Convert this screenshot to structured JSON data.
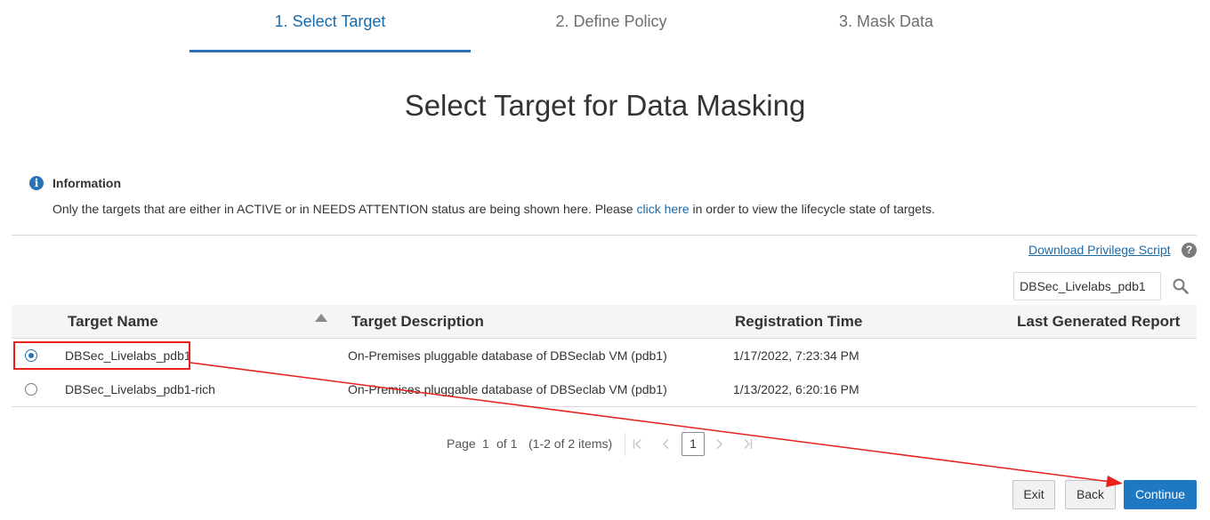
{
  "train": {
    "steps": [
      {
        "label": "1. Select Target",
        "active": true
      },
      {
        "label": "2. Define Policy",
        "active": false
      },
      {
        "label": "3. Mask Data",
        "active": false
      }
    ]
  },
  "page_title": "Select Target for Data Masking",
  "info": {
    "title": "Information",
    "text_before": "Only the targets that are either in ACTIVE or in NEEDS ATTENTION status are being shown here. Please ",
    "link": "click here",
    "text_after": " in order to view the lifecycle state of targets."
  },
  "download_link": "Download Privilege Script",
  "help_icon": "?",
  "search": {
    "value": "DBSec_Livelabs_pdb1"
  },
  "table": {
    "headers": [
      "Target Name",
      "Target Description",
      "Registration Time",
      "Last Generated Report"
    ],
    "sorted_column": "Target Name",
    "rows": [
      {
        "selected": true,
        "name": "DBSec_Livelabs_pdb1",
        "description": "On-Premises pluggable database of DBSeclab VM (pdb1)",
        "registration_time": "1/17/2022, 7:23:34 PM",
        "last_report": ""
      },
      {
        "selected": false,
        "name": "DBSec_Livelabs_pdb1-rich",
        "description": "On-Premises pluggable database of DBSeclab VM (pdb1)",
        "registration_time": "1/13/2022, 6:20:16 PM",
        "last_report": ""
      }
    ]
  },
  "pagination": {
    "page_label": "Page",
    "page": "1",
    "of_label": "of 1",
    "items": "(1-2 of 2 items)",
    "current": "1"
  },
  "buttons": {
    "exit": "Exit",
    "back": "Back",
    "continue": "Continue"
  },
  "colors": {
    "accent": "#2a72b5",
    "annotation": "#e8211d",
    "primary_button": "#1f78c2"
  }
}
